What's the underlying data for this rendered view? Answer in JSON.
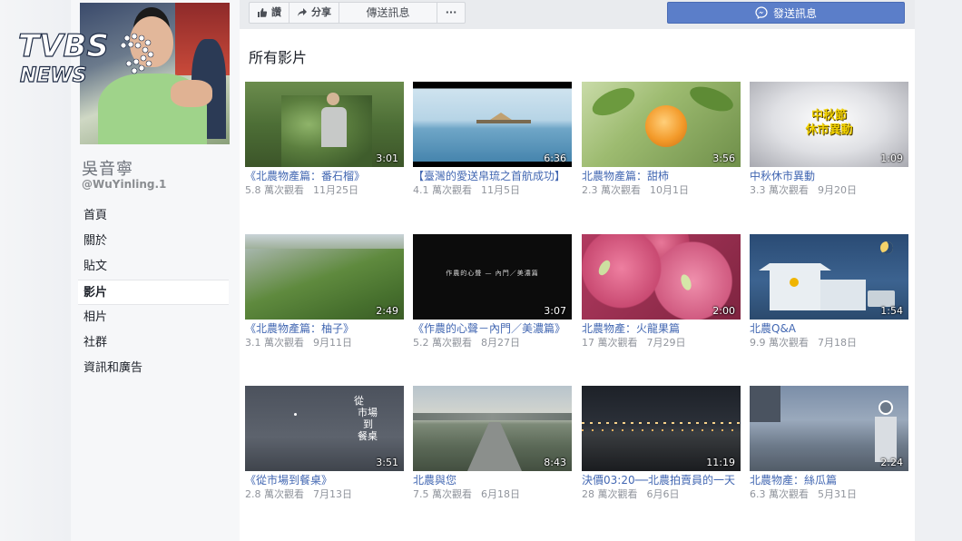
{
  "brand": {
    "logo_text_top": "TVBS",
    "logo_text_bottom": "NEWS"
  },
  "page": {
    "name": "吳音寧",
    "handle": "@WuYinling.1"
  },
  "nav": {
    "items": [
      {
        "label": "首頁"
      },
      {
        "label": "關於"
      },
      {
        "label": "貼文"
      },
      {
        "label": "影片"
      },
      {
        "label": "相片"
      },
      {
        "label": "社群"
      },
      {
        "label": "資訊和廣告"
      }
    ],
    "active": "影片"
  },
  "actions": {
    "like_label": "讚",
    "share_label": "分享",
    "message_label": "傳送訊息",
    "more_label": "···",
    "send_message_label": "發送訊息"
  },
  "section": {
    "title": "所有影片"
  },
  "videos": [
    {
      "title": "《北農物產篇：番石榴》",
      "views": "5.8 萬次觀看",
      "date": "11月25日",
      "duration": "3:01"
    },
    {
      "title": "【臺灣的愛送帛琉之首航成功】",
      "views": "4.1 萬次觀看",
      "date": "11月5日",
      "duration": "6:36"
    },
    {
      "title": "北農物產篇：甜柿",
      "views": "2.3 萬次觀看",
      "date": "10月1日",
      "duration": "3:56"
    },
    {
      "title": "中秋休市異動",
      "views": "3.3 萬次觀看",
      "date": "9月20日",
      "duration": "1:09",
      "overlay_text": [
        "中秋節",
        "休市異動"
      ]
    },
    {
      "title": "《北農物產篇：柚子》",
      "views": "3.1 萬次觀看",
      "date": "9月11日",
      "duration": "2:49"
    },
    {
      "title": "《作農的心聲－內門／美濃篇》",
      "views": "5.2 萬次觀看",
      "date": "8月27日",
      "duration": "3:07",
      "overlay_text": [
        "作農的心聲 — 內門／美濃篇"
      ]
    },
    {
      "title": "北農物產：火龍果篇",
      "views": "17 萬次觀看",
      "date": "7月29日",
      "duration": "2:00"
    },
    {
      "title": "北農Q&A",
      "views": "9.9 萬次觀看",
      "date": "7月18日",
      "duration": "1:54"
    },
    {
      "title": "《從市場到餐桌》",
      "views": "2.8 萬次觀看",
      "date": "7月13日",
      "duration": "3:51",
      "overlay_text": [
        "從",
        "市場",
        "到",
        "餐桌"
      ]
    },
    {
      "title": "北農與您",
      "views": "7.5 萬次觀看",
      "date": "6月18日",
      "duration": "8:43"
    },
    {
      "title": "決價03:20──北農拍賣員的一天",
      "views": "28 萬次觀看",
      "date": "6月6日",
      "duration": "11:19"
    },
    {
      "title": "北農物產：絲瓜篇",
      "views": "6.3 萬次觀看",
      "date": "5月31日",
      "duration": "2:24"
    }
  ],
  "colors": {
    "link": "#4267b2",
    "send_button": "#5b7ec9",
    "meta": "#90949c"
  }
}
